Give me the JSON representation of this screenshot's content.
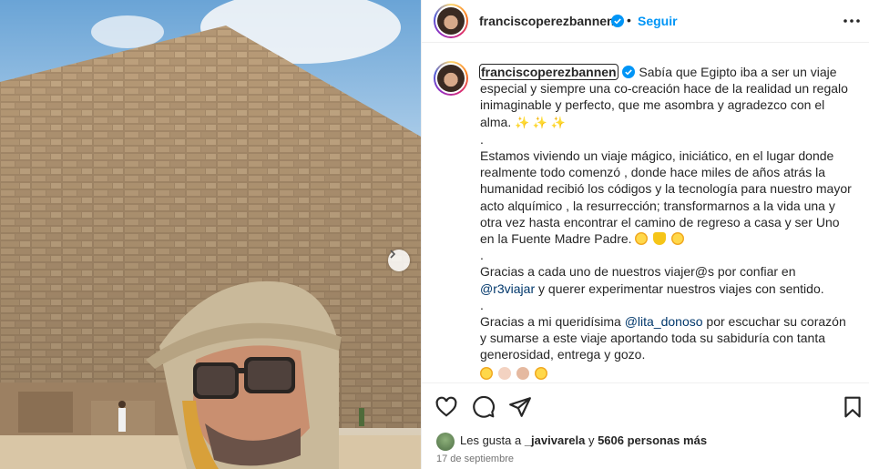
{
  "post": {
    "username": "franciscoperezbannen",
    "separator": "•",
    "follow_label": "Seguir",
    "caption": {
      "username": "franciscoperezbannen",
      "p1": "Sabía que Egipto iba a ser un viaje especial y siempre una co-creación hace de la realidad un regalo inimaginable y perfecto, que me asombra y agradezco con el alma.",
      "p1_emoji": "✨ ✨ ✨",
      "dot1": ".",
      "p2": "Estamos viviendo un viaje mágico, iniciático, en el lugar donde realmente todo comenzó , donde hace miles de años atrás la humanidad recibió los códigos y la tecnología para nuestro mayor acto alquímico , la resurrección; transformarnos a la vida una y otra vez hasta encontrar el camino de regreso a casa y ser Uno en la Fuente Madre Padre.",
      "dot2": ".",
      "p3_before": "Gracias a cada uno de nuestros viajer@s por confiar en ",
      "p3_mention": "@r3viajar",
      "p3_after": " y querer experimentar nuestros viajes con sentido.",
      "dot3": ".",
      "p4_before": "Gracias a mi queridísima ",
      "p4_mention": "@lita_donoso",
      "p4_after": " por escuchar su corazón y sumarse a este viaje aportando toda su sabiduría con tanta generosidad, entrega y gozo."
    },
    "likes": {
      "prefix": "Les gusta a ",
      "user": "_javivarela",
      "middle": " y ",
      "count": "5606 personas más"
    },
    "date": "17 de septiembre"
  },
  "icons": {
    "more": "more-horizontal-icon",
    "like": "heart-icon",
    "comment": "comment-icon",
    "share": "send-icon",
    "save": "bookmark-icon",
    "verified": "verified-badge-icon",
    "next": "chevron-right-icon"
  },
  "colors": {
    "link": "#0095f6",
    "mention": "#00376b",
    "verified": "#0095f6"
  }
}
